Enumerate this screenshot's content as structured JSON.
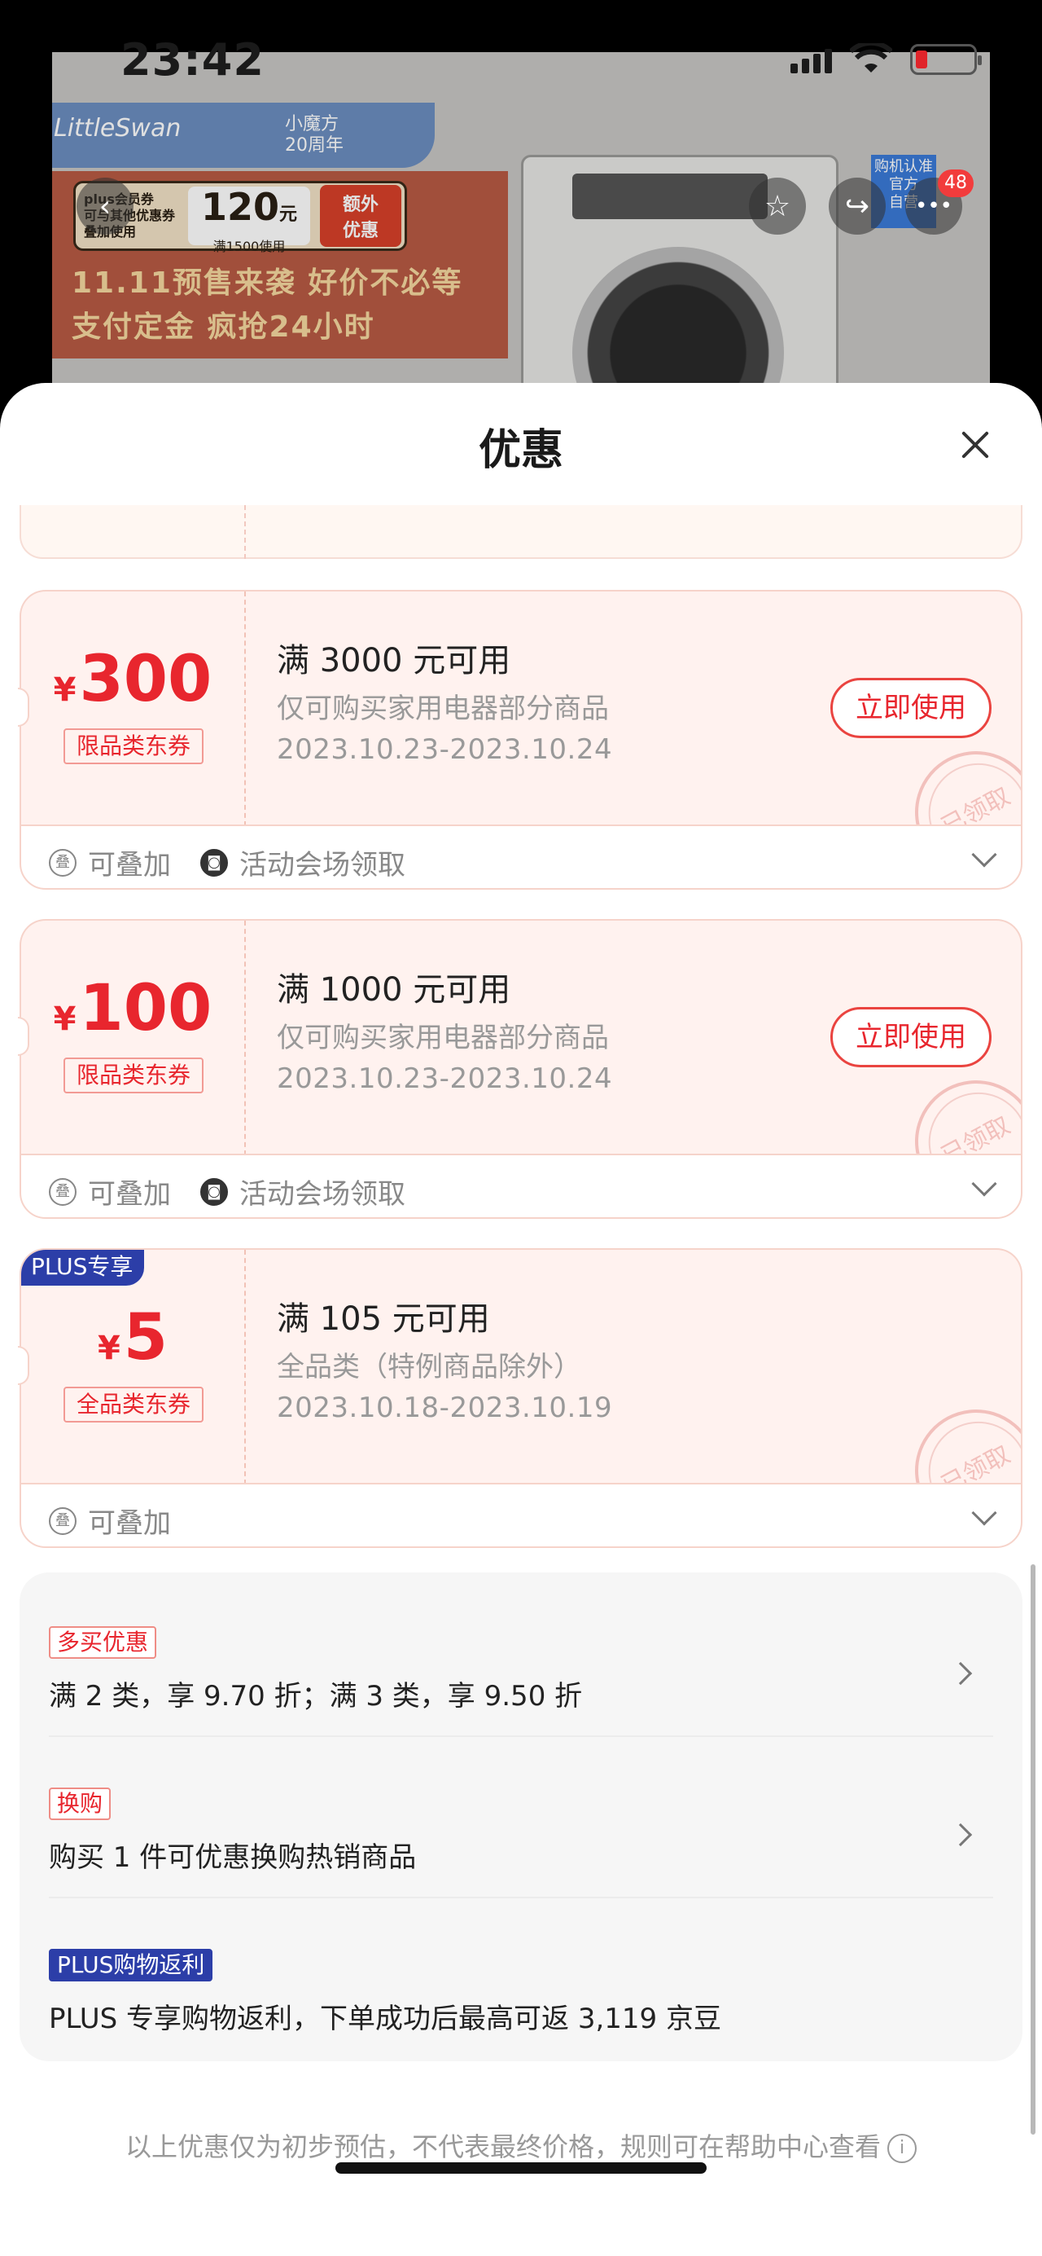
{
  "status_bar": {
    "time": "23:42"
  },
  "background_page": {
    "brand": "LittleSwan",
    "anniversary": "小魔方\n20周年",
    "plus_coupon": {
      "label": "plus会员券\n可与其他优惠券\n叠加使用",
      "amount": "120",
      "unit": "元",
      "condition": "满1500使用",
      "extra": "额外\n优惠"
    },
    "presale_line1": "11.11预售来袭 好价不必等",
    "presale_line2": "支付定金 疯抢24小时",
    "side_box": "购机认准\n官方\n自营",
    "more_badge": "48"
  },
  "sheet": {
    "title": "优惠",
    "coupons": [
      {
        "currency": "¥",
        "amount": "300",
        "type": "限品类东券",
        "condition": "满 3000 元可用",
        "scope": "仅可购买家用电器部分商品",
        "dates": "2023.10.23-2023.10.24",
        "action": "立即使用",
        "stamp": "已领取",
        "stackable": "可叠加",
        "source": "活动会场领取",
        "plus_tag": ""
      },
      {
        "currency": "¥",
        "amount": "100",
        "type": "限品类东券",
        "condition": "满 1000 元可用",
        "scope": "仅可购买家用电器部分商品",
        "dates": "2023.10.23-2023.10.24",
        "action": "立即使用",
        "stamp": "已领取",
        "stackable": "可叠加",
        "source": "活动会场领取",
        "plus_tag": ""
      },
      {
        "currency": "¥",
        "amount": "5",
        "type": "全品类东券",
        "condition": "满 105 元可用",
        "scope": "全品类（特例商品除外）",
        "dates": "2023.10.18-2023.10.19",
        "action": "",
        "stamp": "已领取",
        "stackable": "可叠加",
        "source": "",
        "plus_tag": "PLUS专享"
      }
    ],
    "promotions": [
      {
        "tag": "多买优惠",
        "text": "满 2 类，享 9.70 折；满 3 类，享 9.50 折"
      },
      {
        "tag": "换购",
        "text": "购买 1 件可优惠换购热销商品"
      },
      {
        "tag": "PLUS购物返利",
        "text": "PLUS 专享购物返利，下单成功后最高可返 3,119 京豆"
      }
    ],
    "disclaimer": "以上优惠仅为初步预估，不代表最终价格，规则可在帮助中心查看",
    "info_glyph": "i"
  },
  "icons": {
    "back": "‹",
    "favorite": "☆",
    "share": "↪",
    "more": "•••",
    "stack": "叠",
    "venue": "◙"
  }
}
